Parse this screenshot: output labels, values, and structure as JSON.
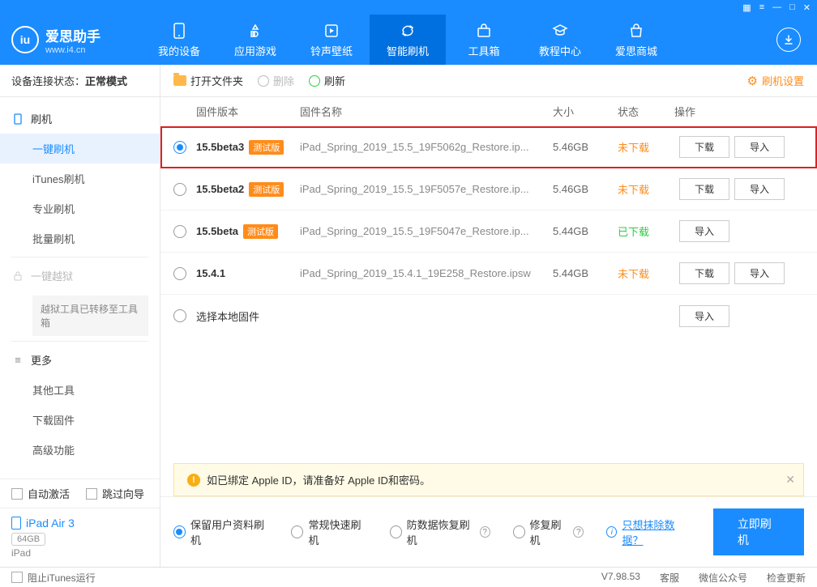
{
  "window": {
    "controls": [
      "▦",
      "≡",
      "—",
      "□",
      "✕"
    ]
  },
  "brand": {
    "name": "爱思助手",
    "url": "www.i4.cn"
  },
  "nav": [
    {
      "id": "device",
      "label": "我的设备"
    },
    {
      "id": "apps",
      "label": "应用游戏"
    },
    {
      "id": "media",
      "label": "铃声壁纸"
    },
    {
      "id": "flash",
      "label": "智能刷机",
      "active": true
    },
    {
      "id": "tools",
      "label": "工具箱"
    },
    {
      "id": "tutorial",
      "label": "教程中心"
    },
    {
      "id": "store",
      "label": "爱思商城"
    }
  ],
  "conn": {
    "label": "设备连接状态：",
    "value": "正常模式"
  },
  "sidebar": {
    "flash_head": "刷机",
    "flash_items": [
      "一键刷机",
      "iTunes刷机",
      "专业刷机",
      "批量刷机"
    ],
    "jb_head": "一键越狱",
    "jb_note": "越狱工具已转移至工具箱",
    "more_head": "更多",
    "more_items": [
      "其他工具",
      "下载固件",
      "高级功能"
    ],
    "auto_activate": "自动激活",
    "skip_guide": "跳过向导"
  },
  "device": {
    "name": "iPad Air 3",
    "storage": "64GB",
    "model": "iPad"
  },
  "toolbar": {
    "open_folder": "打开文件夹",
    "delete": "删除",
    "refresh": "刷新",
    "settings": "刷机设置"
  },
  "columns": {
    "version": "固件版本",
    "name": "固件名称",
    "size": "大小",
    "status": "状态",
    "ops": "操作"
  },
  "firmware": [
    {
      "version": "15.5beta3",
      "beta": true,
      "filename": "iPad_Spring_2019_15.5_19F5062g_Restore.ip...",
      "size": "5.46GB",
      "status": "未下载",
      "status_class": "un",
      "download": true,
      "selected": true,
      "highlight": true
    },
    {
      "version": "15.5beta2",
      "beta": true,
      "filename": "iPad_Spring_2019_15.5_19F5057e_Restore.ip...",
      "size": "5.46GB",
      "status": "未下载",
      "status_class": "un",
      "download": true
    },
    {
      "version": "15.5beta",
      "beta": true,
      "filename": "iPad_Spring_2019_15.5_19F5047e_Restore.ip...",
      "size": "5.44GB",
      "status": "已下载",
      "status_class": "done",
      "download": false
    },
    {
      "version": "15.4.1",
      "beta": false,
      "filename": "iPad_Spring_2019_15.4.1_19E258_Restore.ipsw",
      "size": "5.44GB",
      "status": "未下载",
      "status_class": "un",
      "download": true
    }
  ],
  "local_fw": "选择本地固件",
  "buttons": {
    "download": "下载",
    "import": "导入"
  },
  "notice": "如已绑定 Apple ID，请准备好 Apple ID和密码。",
  "options": {
    "keep_data": "保留用户资料刷机",
    "normal": "常规快速刷机",
    "recover": "防数据恢复刷机",
    "repair": "修复刷机",
    "erase_link": "只想抹除数据？",
    "flash_now": "立即刷机"
  },
  "statusbar": {
    "block_itunes": "阻止iTunes运行",
    "version": "V7.98.53",
    "service": "客服",
    "wechat": "微信公众号",
    "check_update": "检查更新"
  }
}
